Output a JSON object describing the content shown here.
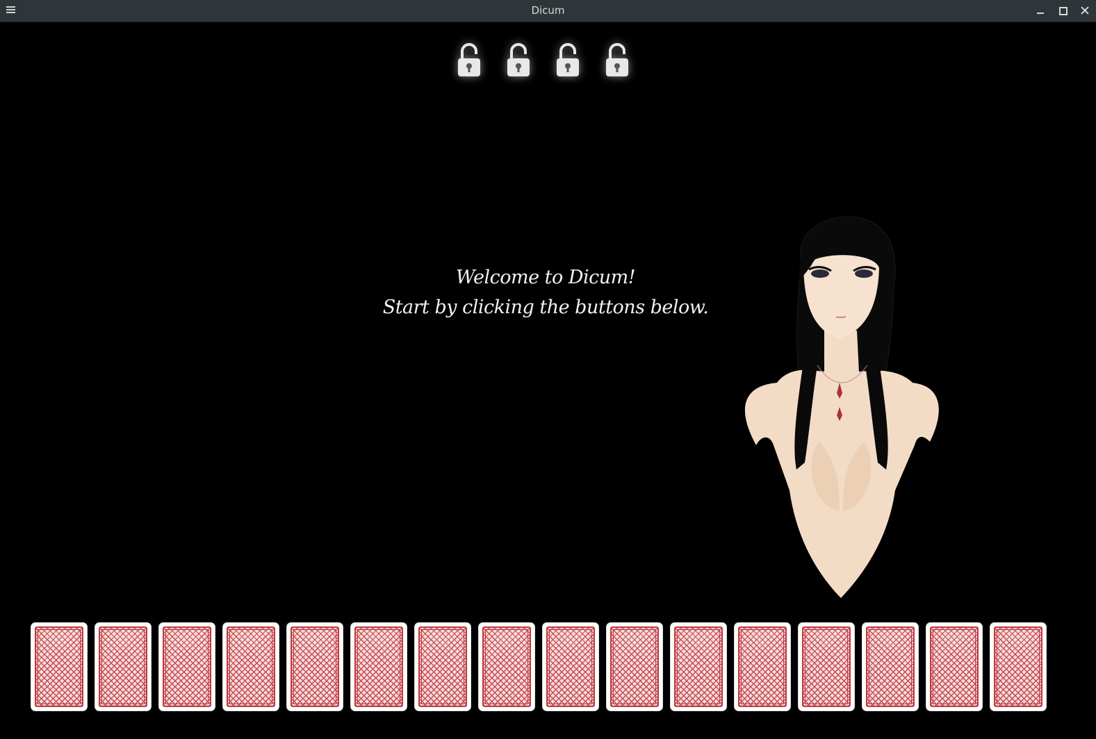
{
  "window": {
    "title": "Dicum",
    "menu_icon": "hamburger-menu-icon",
    "controls": [
      "minimize-icon",
      "maximize-icon",
      "close-icon"
    ]
  },
  "locks": {
    "icon": "padlock-open-icon",
    "count": 4
  },
  "welcome": {
    "line1": "Welcome to Dicum!",
    "line2": "Start by clicking the buttons below."
  },
  "hand": {
    "card_count": 16,
    "card_back_color": "#c0393f"
  },
  "colors": {
    "background": "#000000",
    "titlebar": "#2f3538",
    "text": "#f2f2f2"
  }
}
